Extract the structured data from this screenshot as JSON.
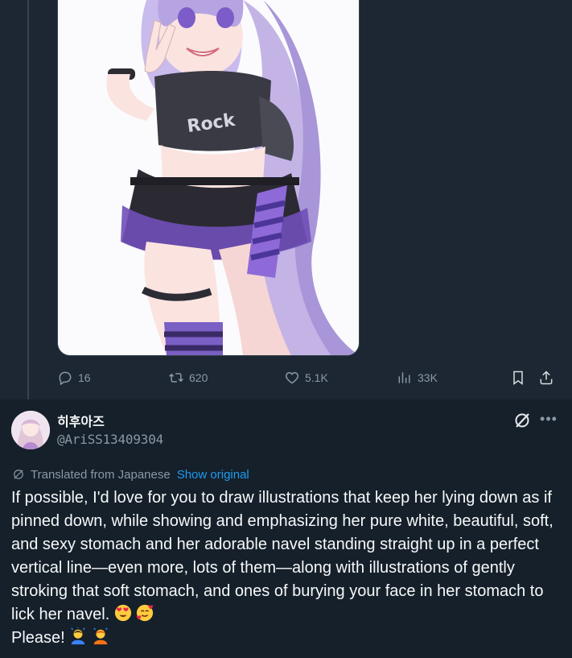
{
  "tweet1": {
    "stats": {
      "replies": "16",
      "retweets": "620",
      "likes": "5.1K",
      "views": "33K"
    },
    "icons": [
      "reply-icon",
      "retweet-icon",
      "like-icon",
      "views-icon",
      "bookmark-icon",
      "share-icon"
    ]
  },
  "tweet2": {
    "display_name": "히후아즈",
    "handle": "@AriSS13409304",
    "translated_label": "Translated from Japanese",
    "show_original": "Show original",
    "text": "If possible, I'd love for you to draw illustrations that keep her lying down as if pinned down, while showing and emphasizing her pure white, beautiful, soft, and sexy stomach and her adorable navel standing straight up in a perfect vertical line—even more, lots of them—along with illustrations of gently stroking that soft stomach, and ones of burying your face in her stomach to lick her navel.",
    "text_end": "Please!",
    "icons": [
      "grok-icon",
      "more-icon",
      "translate-icon"
    ]
  },
  "colors": {
    "background": "#15202b",
    "card": "#1c2733",
    "muted": "#8b98a5",
    "accent": "#1d9bf0",
    "text": "#f7f9f9"
  }
}
